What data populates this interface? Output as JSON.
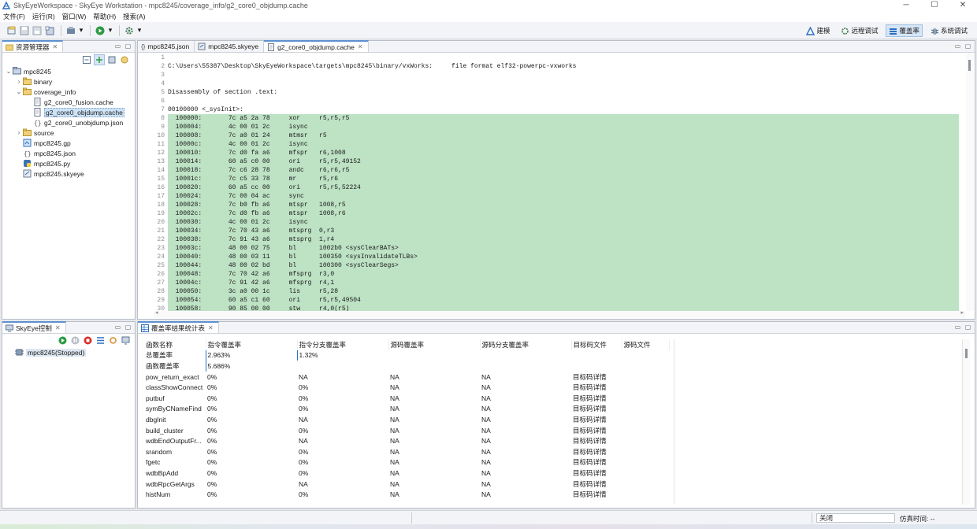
{
  "window": {
    "title": "SkyEyeWorkspace - SkyEye Workstation - mpc8245/coverage_info/g2_core0_objdump.cache",
    "buttons": [
      "─",
      "☐",
      "✕"
    ]
  },
  "menu": [
    "文件(F)",
    "运行(R)",
    "窗口(W)",
    "帮助(H)",
    "搜索(A)"
  ],
  "perspectives": [
    {
      "label": "建模",
      "icon": "modeling-icon"
    },
    {
      "label": "远程调试",
      "icon": "remote-debug-icon"
    },
    {
      "label": "覆盖率",
      "icon": "coverage-icon",
      "active": true
    },
    {
      "label": "系统调试",
      "icon": "system-debug-icon"
    }
  ],
  "explorer": {
    "tab": "资源管理器",
    "tree": [
      {
        "label": "mpc8245",
        "level": 0,
        "arrow": "⌄",
        "icon": "project"
      },
      {
        "label": "binary",
        "level": 1,
        "arrow": "›",
        "icon": "folder"
      },
      {
        "label": "coverage_info",
        "level": 1,
        "arrow": "⌄",
        "icon": "folder"
      },
      {
        "label": "g2_core0_fusion.cache",
        "level": 2,
        "arrow": "",
        "icon": "file"
      },
      {
        "label": "g2_core0_objdump.cache",
        "level": 2,
        "arrow": "",
        "icon": "file",
        "selected": true
      },
      {
        "label": "g2_core0_unobjdump.json",
        "level": 2,
        "arrow": "",
        "icon": "json"
      },
      {
        "label": "source",
        "level": 1,
        "arrow": "›",
        "icon": "folder"
      },
      {
        "label": "mpc8245.gp",
        "level": 1,
        "arrow": "",
        "icon": "gp"
      },
      {
        "label": "mpc8245.json",
        "level": 1,
        "arrow": "",
        "icon": "json"
      },
      {
        "label": "mpc8245.py",
        "level": 1,
        "arrow": "",
        "icon": "py"
      },
      {
        "label": "mpc8245.skyeye",
        "level": 1,
        "arrow": "",
        "icon": "skyeye"
      }
    ]
  },
  "editor": {
    "tabs": [
      {
        "label": "mpc8245.json",
        "icon": "json"
      },
      {
        "label": "mpc8245.skyeye",
        "icon": "skyeye"
      },
      {
        "label": "g2_core0_objdump.cache",
        "icon": "file",
        "active": true
      }
    ],
    "lines": [
      {
        "n": "1",
        "t": "",
        "hl": false
      },
      {
        "n": "2",
        "t": "C:\\Users\\55387\\Desktop\\SkyEyeWorkspace\\targets\\mpc8245\\binary/vxWorks:     file format elf32-powerpc-vxworks",
        "hl": false
      },
      {
        "n": "3",
        "t": "",
        "hl": false
      },
      {
        "n": "4",
        "t": "",
        "hl": false
      },
      {
        "n": "5",
        "t": "Disassembly of section .text:",
        "hl": false
      },
      {
        "n": "6",
        "t": "",
        "hl": false
      },
      {
        "n": "7",
        "t": "00100000 <_sysInit>:",
        "hl": false
      },
      {
        "n": "8",
        "t": "  100000:\t7c a5 2a 78 \txor     r5,r5,r5",
        "hl": true
      },
      {
        "n": "9",
        "t": "  100004:\t4c 00 01 2c \tisync",
        "hl": true
      },
      {
        "n": "10",
        "t": "  100008:\t7c a0 01 24 \tmtmsr   r5",
        "hl": true
      },
      {
        "n": "11",
        "t": "  10000c:\t4c 00 01 2c \tisync",
        "hl": true
      },
      {
        "n": "12",
        "t": "  100010:\t7c d0 fa a6 \tmfspr   r6,1008",
        "hl": true
      },
      {
        "n": "13",
        "t": "  100014:\t60 a5 c0 00 \tori     r5,r5,49152",
        "hl": true
      },
      {
        "n": "14",
        "t": "  100018:\t7c c6 28 78 \tandc    r6,r6,r5",
        "hl": true
      },
      {
        "n": "15",
        "t": "  10001c:\t7c c5 33 78 \tmr      r5,r6",
        "hl": true
      },
      {
        "n": "16",
        "t": "  100020:\t60 a5 cc 00 \tori     r5,r5,52224",
        "hl": true
      },
      {
        "n": "17",
        "t": "  100024:\t7c 00 04 ac \tsync",
        "hl": true
      },
      {
        "n": "18",
        "t": "  100028:\t7c b0 fb a6 \tmtspr   1008,r5",
        "hl": true
      },
      {
        "n": "19",
        "t": "  10002c:\t7c d0 fb a6 \tmtspr   1008,r6",
        "hl": true
      },
      {
        "n": "20",
        "t": "  100030:\t4c 00 01 2c \tisync",
        "hl": true
      },
      {
        "n": "21",
        "t": "  100034:\t7c 70 43 a6 \tmtsprg  0,r3",
        "hl": true
      },
      {
        "n": "22",
        "t": "  100038:\t7c 91 43 a6 \tmtsprg  1,r4",
        "hl": true
      },
      {
        "n": "23",
        "t": "  10003c:\t48 00 02 75 \tbl      1002b0 <sysClearBATs>",
        "hl": true
      },
      {
        "n": "24",
        "t": "  100040:\t48 00 03 11 \tbl      100350 <sysInvalidateTLBs>",
        "hl": true
      },
      {
        "n": "25",
        "t": "  100044:\t48 00 02 bd \tbl      100300 <sysClearSegs>",
        "hl": true
      },
      {
        "n": "26",
        "t": "  100048:\t7c 70 42 a6 \tmfsprg  r3,0",
        "hl": true
      },
      {
        "n": "27",
        "t": "  10004c:\t7c 91 42 a6 \tmfsprg  r4,1",
        "hl": true
      },
      {
        "n": "28",
        "t": "  100050:\t3c a0 00 1c \tlis     r5,28",
        "hl": true
      },
      {
        "n": "29",
        "t": "  100054:\t60 a5 c1 60 \tori     r5,r5,49504",
        "hl": true
      },
      {
        "n": "30",
        "t": "  100058:\t90 85 00 00 \tstw     r4,0(r5)",
        "hl": true
      }
    ]
  },
  "control": {
    "tab": "SkyEye控制",
    "item": "mpc8245(Stopped)"
  },
  "coverage": {
    "tab": "覆盖率结果统计表",
    "headers": [
      "函数名称",
      "指令覆盖率",
      "指令分支覆盖率",
      "源码覆盖率",
      "源码分支覆盖率",
      "目标码文件",
      "源码文件"
    ],
    "rows": [
      [
        "总覆盖率",
        "2.963%",
        "1.32%",
        "",
        "",
        "",
        ""
      ],
      [
        "函数覆盖率",
        "5.686%",
        "",
        "",
        "",
        "",
        ""
      ],
      [
        "pow_return_exact",
        "0%",
        "NA",
        "NA",
        "NA",
        "目标码详情",
        ""
      ],
      [
        "classShowConnect",
        "0%",
        "0%",
        "NA",
        "NA",
        "目标码详情",
        ""
      ],
      [
        "putbuf",
        "0%",
        "0%",
        "NA",
        "NA",
        "目标码详情",
        ""
      ],
      [
        "symByCNameFind",
        "0%",
        "0%",
        "NA",
        "NA",
        "目标码详情",
        ""
      ],
      [
        "dbgInit",
        "0%",
        "NA",
        "NA",
        "NA",
        "目标码详情",
        ""
      ],
      [
        "build_cluster",
        "0%",
        "0%",
        "NA",
        "NA",
        "目标码详情",
        ""
      ],
      [
        "wdbEndOutputFr...",
        "0%",
        "NA",
        "NA",
        "NA",
        "目标码详情",
        ""
      ],
      [
        "srandom",
        "0%",
        "0%",
        "NA",
        "NA",
        "目标码详情",
        ""
      ],
      [
        "fgetc",
        "0%",
        "0%",
        "NA",
        "NA",
        "目标码详情",
        ""
      ],
      [
        "wdbBpAdd",
        "0%",
        "0%",
        "NA",
        "NA",
        "目标码详情",
        ""
      ],
      [
        "wdbRpcGetArgs",
        "0%",
        "NA",
        "NA",
        "NA",
        "目标码详情",
        ""
      ],
      [
        "histNum",
        "0%",
        "0%",
        "NA",
        "NA",
        "目标码详情",
        ""
      ]
    ]
  },
  "status": {
    "button": "关闭",
    "sim_time_label": "仿真时间: --"
  },
  "colors": {
    "highlight": "#bde2c4",
    "accent": "#5c91d0",
    "selection": "#cde3f7"
  }
}
